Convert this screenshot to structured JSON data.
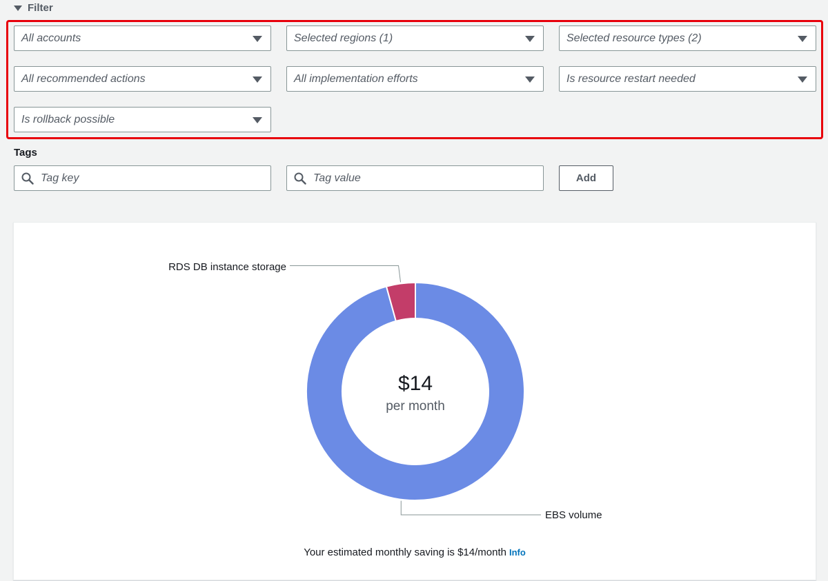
{
  "filter": {
    "title": "Filter",
    "selects": [
      "All accounts",
      "Selected regions (1)",
      "Selected resource types (2)",
      "All recommended actions",
      "All implementation efforts",
      "Is resource restart needed",
      "Is rollback possible"
    ]
  },
  "tags": {
    "label": "Tags",
    "key_placeholder": "Tag key",
    "value_placeholder": "Tag value",
    "add_label": "Add"
  },
  "summary": {
    "center_value": "$14",
    "center_unit": "per month",
    "saving_text": "Your estimated monthly saving is $14/month",
    "info_link": "Info"
  },
  "colors": {
    "accent_highlight": "#e8000b",
    "ebs": "#6b8be5",
    "rds": "#c33d69"
  },
  "chart_data": {
    "type": "pie",
    "categories": [
      "RDS DB instance storage",
      "EBS volume"
    ],
    "values": [
      0.6,
      13.4
    ],
    "title": "",
    "legend": "none"
  }
}
